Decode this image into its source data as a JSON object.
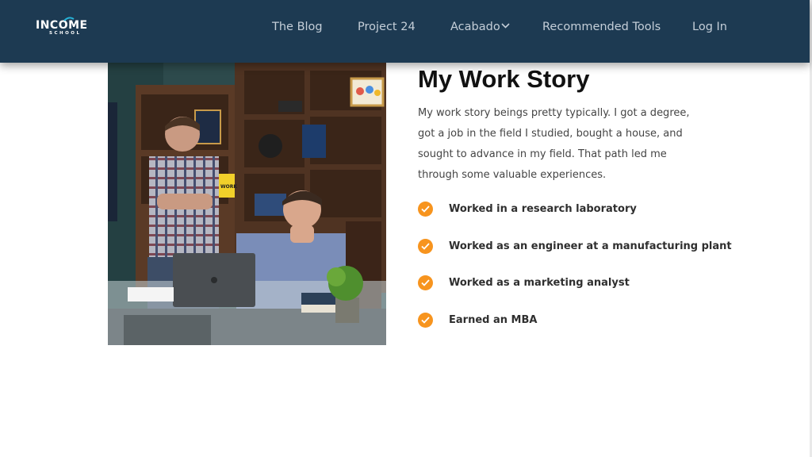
{
  "header": {
    "logo": {
      "main": "INCOME",
      "sub": "SCHOOL"
    },
    "nav": [
      {
        "label": "The Blog"
      },
      {
        "label": "Project 24"
      },
      {
        "label": "Acabado",
        "has_dropdown": true
      },
      {
        "label": "Recommended Tools"
      },
      {
        "label": "Log In"
      }
    ]
  },
  "main": {
    "title": "My Work Story",
    "intro": "My work story beings pretty typically.  I got a degree, got a job in the field I studied, bought a house, and sought to advance in my field.  That path led me through some valuable experiences.",
    "checklist": [
      {
        "label": "Worked in a research laboratory"
      },
      {
        "label": "Worked as an engineer at a manufacturing plant"
      },
      {
        "label": "Worked as a marketing analyst"
      },
      {
        "label": "Earned an MBA"
      }
    ],
    "photo_sign_text": "WORK"
  },
  "colors": {
    "header_bg": "#1d3a52",
    "nav_text": "#c4ced8",
    "check_accent": "#f7941e",
    "title_text": "#111111",
    "body_text": "#444444"
  },
  "icons": {
    "logo": "income-school-logo",
    "dropdown": "chevron-down-icon",
    "check": "check-circle-icon"
  }
}
